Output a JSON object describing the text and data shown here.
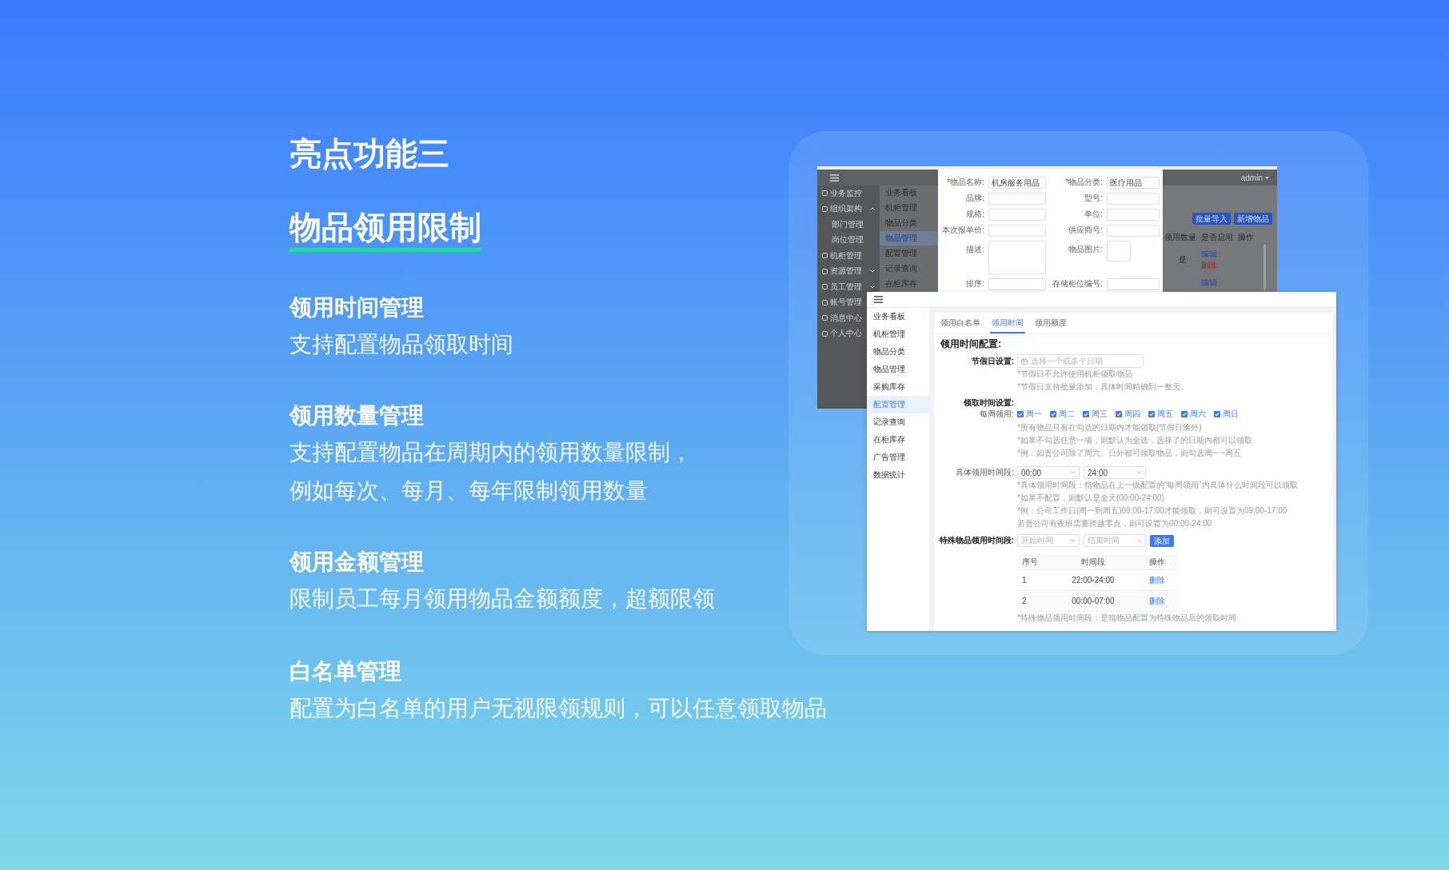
{
  "headline": {
    "eyebrow": "亮点功能三",
    "title": "物品领用限制"
  },
  "features": [
    {
      "title": "领用时间管理",
      "lines": [
        "支持配置物品领取时间"
      ]
    },
    {
      "title": "领用数量管理",
      "lines": [
        "支持配置物品在周期内的领用数量限制，",
        "例如每次、每月、每年限制领用数量"
      ]
    },
    {
      "title": "领用金额管理",
      "lines": [
        "限制员工每月领用物品金额额度，超额限领"
      ]
    },
    {
      "title": "白名单管理",
      "lines": [
        "配置为白名单的用户无视限领规则，可以任意领取物品"
      ]
    }
  ],
  "back_window": {
    "user_menu": "admin",
    "sidebar": [
      {
        "label": "业务监控",
        "kind": "link"
      },
      {
        "label": "组织架构",
        "kind": "group",
        "expanded": true,
        "children": [
          {
            "label": "部门管理"
          },
          {
            "label": "岗位管理"
          }
        ]
      },
      {
        "label": "机柜管理",
        "kind": "link"
      },
      {
        "label": "资源管理",
        "kind": "group",
        "expanded": false
      },
      {
        "label": "员工管理",
        "kind": "group",
        "expanded": false
      },
      {
        "label": "账号管理",
        "kind": "link"
      },
      {
        "label": "消息中心",
        "kind": "link"
      },
      {
        "label": "个人中心",
        "kind": "link"
      }
    ],
    "submenu": [
      {
        "label": "业务看板",
        "selected": false
      },
      {
        "label": "机柜管理",
        "selected": false
      },
      {
        "label": "物品分类",
        "selected": false
      },
      {
        "label": "物品管理",
        "selected": true
      },
      {
        "label": "配置管理",
        "selected": false
      },
      {
        "label": "记录查询",
        "selected": false
      },
      {
        "label": "在柜库存",
        "selected": false
      }
    ],
    "form": [
      {
        "label": "*物品名称:",
        "kind": "input",
        "value": "机房服务用品"
      },
      {
        "label": "*物品分类:",
        "kind": "input",
        "value": "医疗用品"
      },
      {
        "label": "品牌:",
        "kind": "input"
      },
      {
        "label": "型号:",
        "kind": "input"
      },
      {
        "label": "规格:",
        "kind": "input"
      },
      {
        "label": "单位:",
        "kind": "input"
      },
      {
        "label": "本次报单价:",
        "kind": "input"
      },
      {
        "label": "供应商号:",
        "kind": "input"
      },
      {
        "label": "描述:",
        "kind": "textarea"
      },
      {
        "label": "物品图片:",
        "kind": "upload"
      },
      {
        "label": "排序:",
        "kind": "input"
      },
      {
        "label": "存储柜位编号:",
        "kind": "input"
      }
    ],
    "buttons": [
      "批量导入",
      "新增物品"
    ],
    "table": {
      "columns": [
        "领用数量",
        "是否启用",
        "操作"
      ],
      "rows": [
        {
          "status": "是",
          "actions": [
            {
              "label": "编辑",
              "kind": "edit"
            },
            {
              "label": "删除",
              "kind": "delete"
            }
          ]
        },
        {
          "actions": [
            {
              "label": "编辑",
              "kind": "edit"
            }
          ]
        }
      ]
    }
  },
  "front_window": {
    "sidebar": [
      {
        "label": "业务看板",
        "selected": false
      },
      {
        "label": "机柜管理",
        "selected": false
      },
      {
        "label": "物品分类",
        "selected": false
      },
      {
        "label": "物品管理",
        "selected": false
      },
      {
        "label": "采购库存",
        "selected": false
      },
      {
        "label": "配置管理",
        "selected": true
      },
      {
        "label": "记录查询",
        "selected": false
      },
      {
        "label": "在柜库存",
        "selected": false
      },
      {
        "label": "广告管理",
        "selected": false
      },
      {
        "label": "数据统计",
        "selected": false
      }
    ],
    "tabs": [
      {
        "label": "领用白名单",
        "selected": false
      },
      {
        "label": "领用时间",
        "selected": true
      },
      {
        "label": "领用额度",
        "selected": false
      }
    ],
    "heading": "领用时间配置:",
    "holiday": {
      "label": "节假日设置:",
      "placeholder": "选择一个或多个日期",
      "hints": [
        "*节假日不允许使用机柜领取物品",
        "*节假日支持批量添加，具体时间精确到一整天。"
      ]
    },
    "pickup_time": {
      "label": "领取时间设置:"
    },
    "weekdays": {
      "label": "每周领用:",
      "days": [
        {
          "label": "周一",
          "checked": true
        },
        {
          "label": "周二",
          "checked": true
        },
        {
          "label": "周三",
          "checked": true
        },
        {
          "label": "周四",
          "checked": true
        },
        {
          "label": "周五",
          "checked": true
        },
        {
          "label": "周六",
          "checked": true
        },
        {
          "label": "周日",
          "checked": true
        }
      ],
      "hints": [
        "*所有物品只有在勾选的日期内才能领取(节假日除外)",
        "*如果不勾选任意一项，则默认为全选，选择了的日期内都可以领取",
        "*例：如贵公司除了周六、日外都可领取物品，则勾选周一~周五"
      ]
    },
    "time_range": {
      "label": "具体领用时间段:",
      "start": "00:00",
      "end": "24:00",
      "hints": [
        "*具体领用时间段：指物品在上一级配置的“每周领用”内具体什么时间段可以领取",
        "*如果不配置，则默认是全天(00:00-24:00)",
        "*例：公司工作日(周一到周五)09:00-17:00才能领取，则可设置为09:00-17:00",
        "若贵公司有夜班需要跨越零点，则可设置为00:00-24:00"
      ]
    },
    "special_time": {
      "label": "特殊物品领用时间段:",
      "start_placeholder": "开始时间",
      "end_placeholder": "结束时间",
      "button": "添加",
      "table": {
        "columns": [
          "序号",
          "时间段",
          "操作"
        ],
        "rows": [
          {
            "index": "1",
            "range": "22:00-24:00",
            "action": "删除"
          },
          {
            "index": "2",
            "range": "00:00-07:00",
            "action": "删除"
          }
        ]
      },
      "hint": "*特殊物品领用时间段：是指物品配置为特殊物品后的领取时间"
    }
  }
}
